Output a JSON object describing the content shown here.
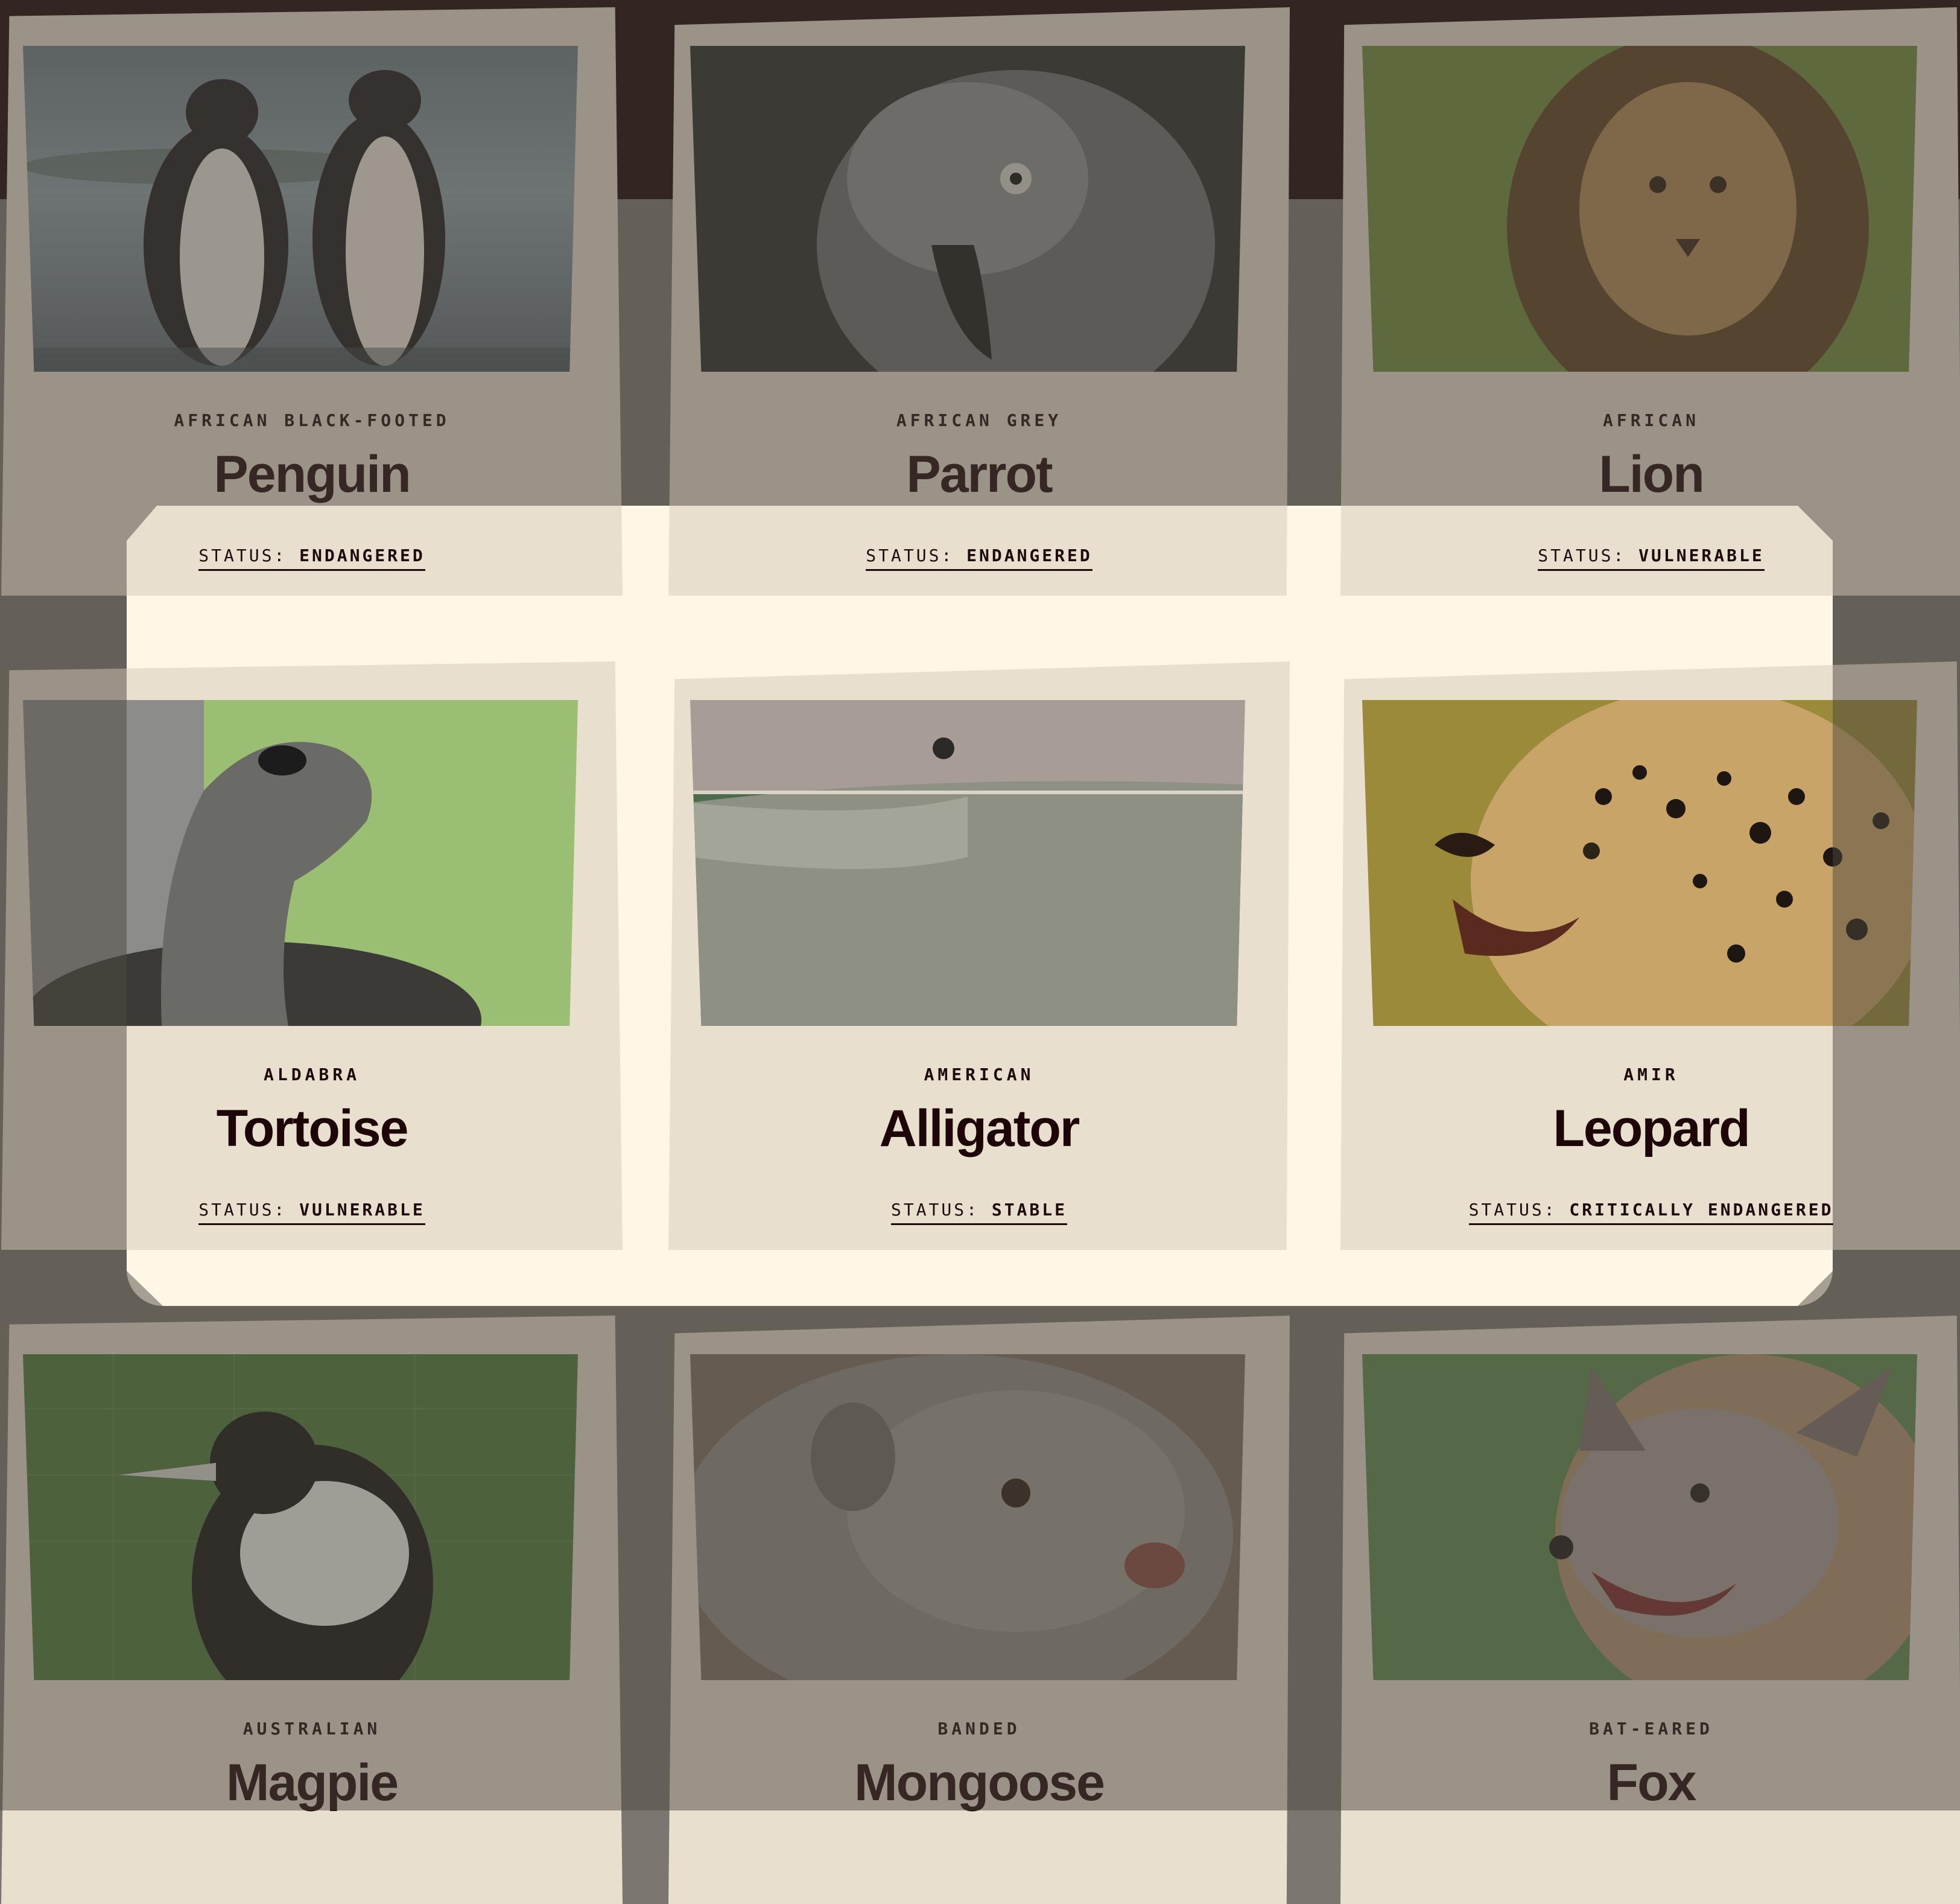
{
  "status_prefix": "STATUS: ",
  "cards": [
    {
      "species": "AFRICAN BLACK-FOOTED",
      "name": "Penguin",
      "status": "ENDANGERED",
      "photo": "penguin"
    },
    {
      "species": "AFRICAN GREY",
      "name": "Parrot",
      "status": "ENDANGERED",
      "photo": "parrot"
    },
    {
      "species": "AFRICAN",
      "name": "Lion",
      "status": "VULNERABLE",
      "photo": "lion"
    },
    {
      "species": "ALDABRA",
      "name": "Tortoise",
      "status": "VULNERABLE",
      "photo": "tortoise"
    },
    {
      "species": "AMERICAN",
      "name": "Alligator",
      "status": "STABLE",
      "photo": "alligator"
    },
    {
      "species": "AMIR",
      "name": "Leopard",
      "status": "CRITICALLY ENDANGERED",
      "photo": "leopard"
    },
    {
      "species": "AUSTRALIAN",
      "name": "Magpie",
      "status": "",
      "photo": "magpie"
    },
    {
      "species": "BANDED",
      "name": "Mongoose",
      "status": "",
      "photo": "mongoose"
    },
    {
      "species": "BAT-EARED",
      "name": "Fox",
      "status": "",
      "photo": "fox"
    }
  ],
  "colors": {
    "page_bg": "#7b766e",
    "top_band": "#170205",
    "card_bg": "#e8dfcf",
    "highlight_bg": "#fff7e6",
    "text_dark": "#1e0608"
  }
}
